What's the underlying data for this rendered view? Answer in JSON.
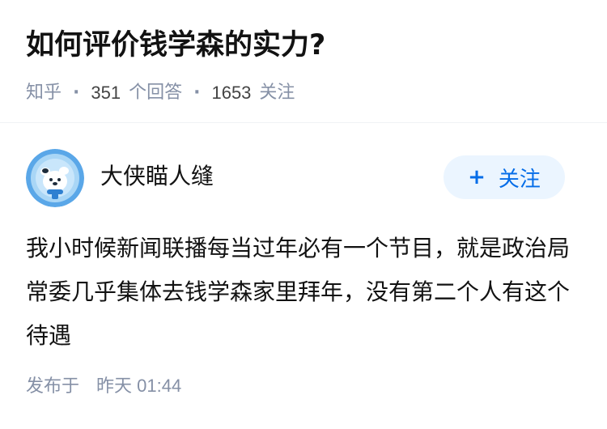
{
  "question": {
    "title": "如何评价钱学森的实力?",
    "source": "知乎",
    "answers_count": "351",
    "answers_label": "个回答",
    "followers_count": "1653",
    "followers_label": "关注"
  },
  "answer": {
    "author_name": "大侠瞄人缝",
    "follow_button_label": "关注",
    "follow_icon": "plus-icon",
    "avatar_icon": "mascot-avatar",
    "content": "我小时候新闻联播每当过年必有一个节目，就是政治局常委几乎集体去钱学森家里拜年，没有第二个人有这个待遇",
    "published_label": "发布于",
    "published_time": "昨天 01:44"
  },
  "colors": {
    "accent": "#056de8",
    "button_bg": "#ebf5ff",
    "meta_text": "#8590a6",
    "main_text": "#121212"
  }
}
